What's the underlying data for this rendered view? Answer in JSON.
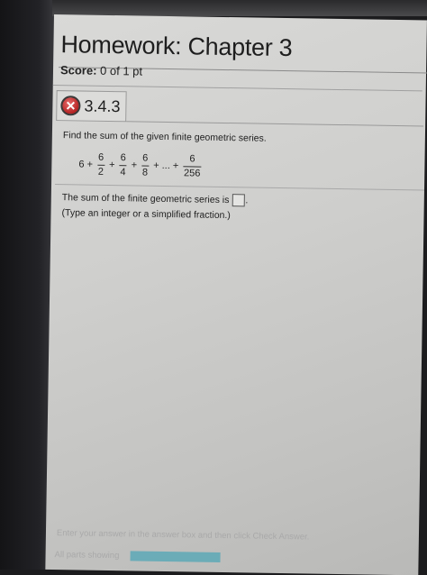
{
  "header": {
    "title": "Homework: Chapter 3",
    "score_label": "Score:",
    "score_value": "0 of 1 pt"
  },
  "question": {
    "number": "3.4.3",
    "status_icon": "x-icon",
    "prompt": "Find the sum of the given finite geometric series.",
    "series": {
      "first": "6",
      "terms": [
        {
          "num": "6",
          "den": "2"
        },
        {
          "num": "6",
          "den": "4"
        },
        {
          "num": "6",
          "den": "8"
        }
      ],
      "ellipsis": "...",
      "last": {
        "num": "6",
        "den": "256"
      }
    },
    "answer_text": "The sum of the finite geometric series is",
    "answer_value": "",
    "answer_suffix": ".",
    "hint": "(Type an integer or a simplified fraction.)"
  },
  "footer": {
    "instruction": "Enter your answer in the answer box and then click Check Answer.",
    "parts_label": "All parts showing"
  },
  "colors": {
    "wrong": "#b52424",
    "progress": "#4fa6b6"
  }
}
